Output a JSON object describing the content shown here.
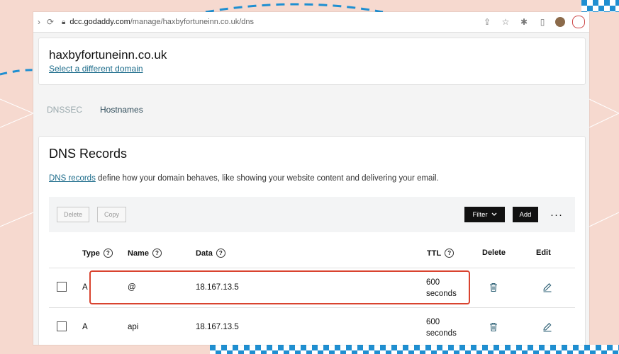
{
  "browser": {
    "url_domain": "dcc.godaddy.com",
    "url_path": "/manage/haxbyfortuneinn.co.uk/dns"
  },
  "domain_card": {
    "domain": "haxbyfortuneinn.co.uk",
    "change_link": "Select a different domain"
  },
  "tabs": [
    {
      "label": "DNSSEC",
      "state": "dim"
    },
    {
      "label": "Hostnames",
      "state": "active"
    }
  ],
  "dns": {
    "title": "DNS Records",
    "desc_link": "DNS records",
    "desc_text": " define how your domain behaves, like showing your website content and delivering your email.",
    "actions": {
      "delete": "Delete",
      "copy": "Copy",
      "filter": "Filter",
      "add": "Add",
      "more": "···"
    },
    "columns": {
      "type": "Type",
      "name": "Name",
      "data": "Data",
      "ttl": "TTL",
      "delete": "Delete",
      "edit": "Edit"
    },
    "rows": [
      {
        "type": "A",
        "name": "@",
        "data": "18.167.13.5",
        "ttl_value": "600",
        "ttl_unit": "seconds",
        "highlighted": true
      },
      {
        "type": "A",
        "name": "api",
        "data": "18.167.13.5",
        "ttl_value": "600",
        "ttl_unit": "seconds",
        "highlighted": false
      }
    ]
  },
  "colors": {
    "accent_link": "#1b6b8a",
    "highlight": "#d9432f",
    "dark_button": "#111111"
  }
}
